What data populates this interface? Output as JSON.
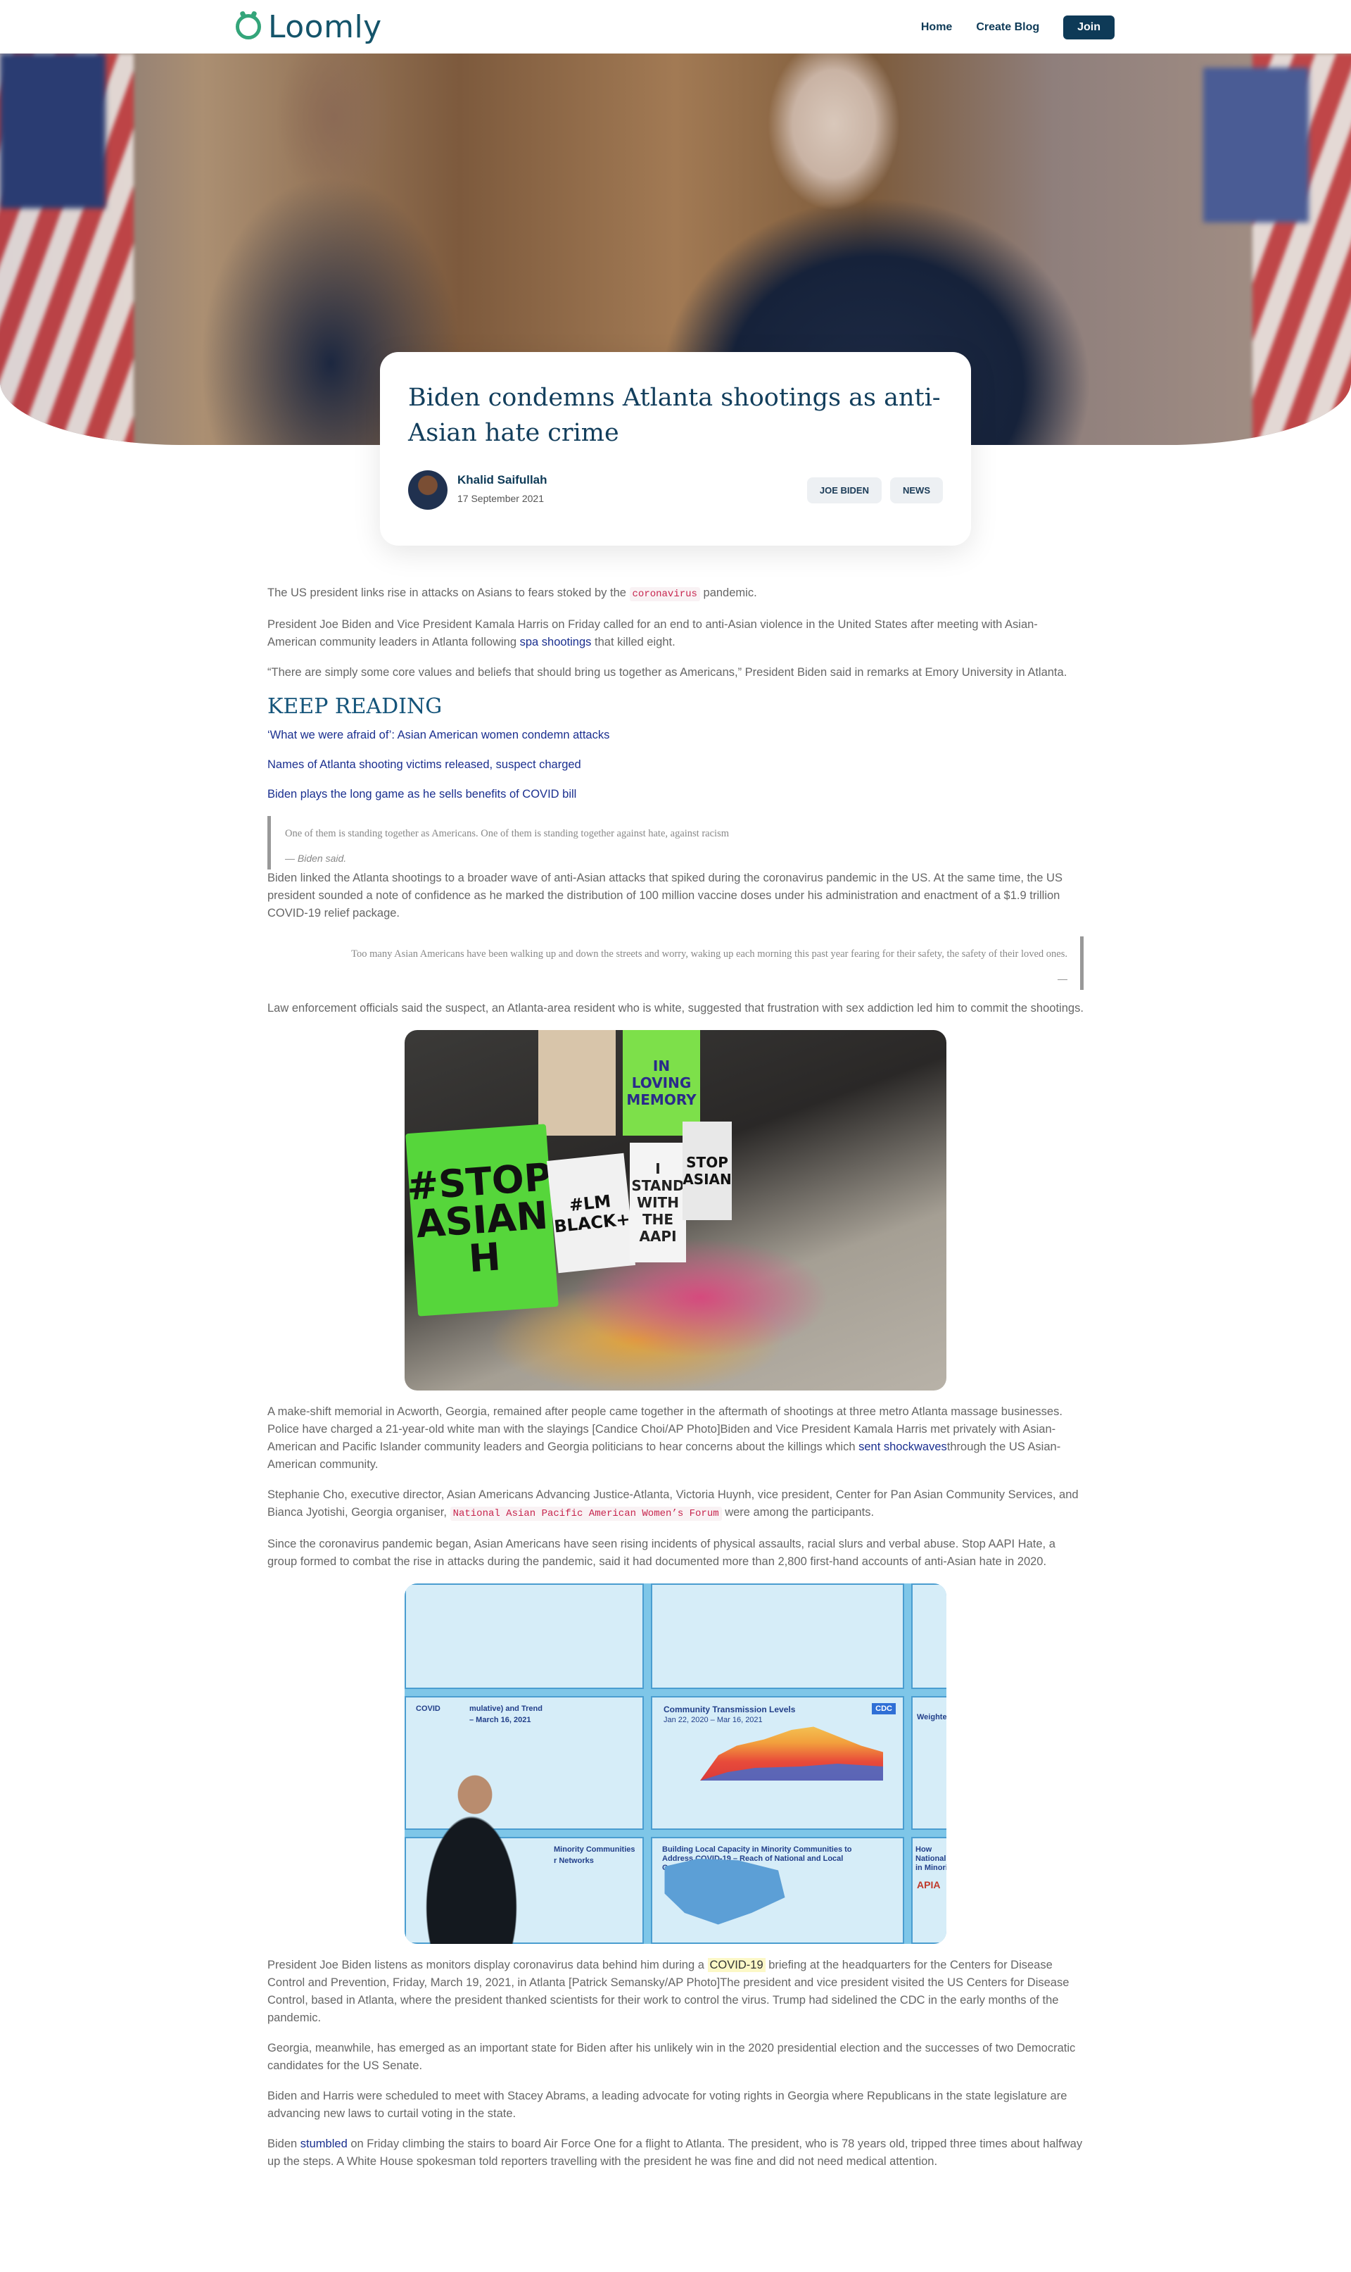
{
  "nav": {
    "brand": "Loomly",
    "links": [
      "Home",
      "Create Blog"
    ],
    "join_label": "Join"
  },
  "post": {
    "title": "Biden condemns Atlanta shootings as anti-Asian hate crime",
    "author": "Khalid Saifullah",
    "date": "17 September 2021",
    "tags": [
      "JOE BIDEN",
      "NEWS"
    ]
  },
  "article": {
    "p1_pre": "The US president links rise in attacks on Asians to fears stoked by the ",
    "p1_code": "coronavirus",
    "p1_post": " pandemic.",
    "p2_pre": "President Joe Biden and Vice President Kamala Harris on Friday called for an end to anti-Asian violence in the United States after meeting with Asian-American community leaders in Atlanta following ",
    "p2_link": "spa shootings",
    "p2_post": " that killed eight.",
    "p3": "“There are simply some core values and beliefs that should bring us together as Americans,” President Biden said in remarks at Emory University in Atlanta.",
    "keep_reading_heading": "KEEP READING",
    "keep_reading_links": [
      "‘What we were afraid of’: Asian American women condemn attacks",
      "Names of Atlanta shooting victims released, suspect charged",
      "Biden plays the long game as he sells benefits of COVID bill"
    ],
    "quote1_text": "One of them is standing together as Americans. One of them is standing together against hate, against racism",
    "quote1_cite": "— Biden said.",
    "p4": "Biden linked the Atlanta shootings to a broader wave of anti-Asian attacks that spiked during the coronavirus pandemic in the US. At the same time, the US president sounded a note of confidence as he marked the distribution of 100 million vaccine doses under his administration and enactment of a $1.9 trillion COVID-19 relief package.",
    "quote2_text": "Too many Asian Americans have been walking up and down the streets and worry, waking up each morning this past year fearing for their safety, the safety of their loved ones.",
    "quote2_cite": "—",
    "p5": "Law enforcement officials said the suspect, an Atlanta-area resident who is white, suggested that frustration with sex addiction led him to commit the shootings.",
    "p6_pre": "A make-shift memorial in Acworth, Georgia, remained after people came together in the aftermath of shootings at three metro Atlanta massage businesses. Police have charged a 21-year-old white man with the slayings [Candice Choi/AP Photo]Biden and Vice President Kamala Harris met privately with Asian-American and Pacific Islander community leaders and Georgia politicians to hear concerns about the killings which ",
    "p6_link": "sent shockwaves",
    "p6_post": "through the US Asian-American community.",
    "p7_pre": "Stephanie Cho, executive director, Asian Americans Advancing Justice-Atlanta, Victoria Huynh, vice president, Center for Pan Asian Community Services, and Bianca Jyotishi, Georgia organiser, ",
    "p7_code": "National Asian Pacific American Women’s Forum",
    "p7_post": " were among the participants.",
    "p8": "Since the coronavirus pandemic began, Asian Americans have seen rising incidents of physical assaults, racial slurs and verbal abuse. Stop AAPI Hate, a group formed to combat the rise in attacks during the pandemic, said it had documented more than 2,800 first-hand accounts of anti-Asian hate in 2020.",
    "p9_pre": "President Joe Biden listens as monitors display coronavirus data behind him during a ",
    "p9_mark": "COVID-19",
    "p9_post": " briefing at the headquarters for the Centers for Disease Control and Prevention, Friday, March 19, 2021, in Atlanta [Patrick Semansky/AP Photo]The president and vice president visited the US Centers for Disease Control, based in Atlanta, where the president thanked scientists for their work to control the virus. Trump had sidelined the CDC in the early months of the pandemic.",
    "p10": "Georgia, meanwhile, has emerged as an important state for Biden after his unlikely win in the 2020 presidential election and the successes of two Democratic candidates for the US Senate.",
    "p11": "Biden and Harris were scheduled to meet with Stacey Abrams, a leading advocate for voting rights in Georgia where Republicans in the state legislature are advancing new laws to curtail voting in the state.",
    "p12_pre": "Biden ",
    "p12_link": "stumbled",
    "p12_post": " on Friday climbing the stairs to board Air Force One for a flight to Atlanta. The president, who is 78 years old, tripped three times about halfway up the steps. A White House spokesman told reporters travelling with the president he was fine and did not need medical attention."
  },
  "memorial_photo": {
    "sign_green": "#STOP ASIAN H",
    "sign_green2": "IN LOVING MEMORY",
    "sign_white1": "#LM BLACK+",
    "sign_white2": "I STAND WITH THE AAPI",
    "sign_white3": "STOP ASIAN"
  },
  "cdc_photo": {
    "panel_community": "Community Transmission Levels",
    "panel_community_sub": "Jan 22, 2020 – Mar 16, 2021",
    "panel_covid": "COVID",
    "panel_covid_sub": "mulative) and Trend",
    "panel_covid_date": "– March 16, 2021",
    "panel_building": "Building Local Capacity in Minority Communities to Address COVID-19 – Reach of National and Local Organizations by State",
    "panel_minority": "Minority Communities",
    "panel_networks": "r Networks",
    "panel_weighted": "Weighted",
    "panel_apia": "APIA",
    "panel_national": "How National in Minority",
    "cdc_badge": "CDC"
  },
  "colors": {
    "accent_navy": "#0e3a57",
    "brand_green": "#34a57a",
    "link": "#1a2f8f",
    "code_red": "#c7254e"
  }
}
